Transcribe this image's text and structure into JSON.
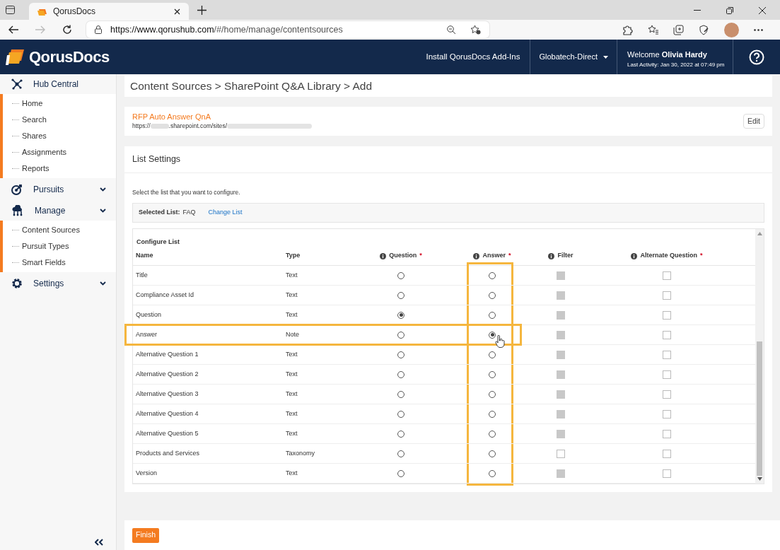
{
  "browser": {
    "tab_title": "QorusDocs",
    "url_host": "https://www.qorushub.com",
    "url_path": "/#/home/manage/contentsources"
  },
  "header": {
    "logo": "QorusDocs",
    "install": "Install QorusDocs Add-Ins",
    "org": "Globatech-Direct",
    "welcome": "Welcome",
    "user": "Olivia Hardy",
    "last_activity": "Last Activity: Jan 30, 2022 at 07:49 pm"
  },
  "sidebar": {
    "sections": [
      {
        "label": "Hub Central",
        "kind": "network",
        "collapsible": false,
        "children": [
          {
            "label": "Home"
          },
          {
            "label": "Search"
          },
          {
            "label": "Shares"
          },
          {
            "label": "Assignments"
          },
          {
            "label": "Reports"
          }
        ]
      },
      {
        "label": "Pursuits",
        "kind": "target",
        "collapsible": true
      },
      {
        "label": "Manage",
        "kind": "cloud",
        "collapsible": true,
        "children": [
          {
            "label": "Content Sources"
          },
          {
            "label": "Pursuit Types"
          },
          {
            "label": "Smart Fields"
          }
        ]
      },
      {
        "label": "Settings",
        "kind": "gear",
        "collapsible": true
      }
    ]
  },
  "breadcrumb": "Content Sources > SharePoint Q&A Library > Add",
  "source": {
    "title": "RFP Auto Answer QnA",
    "url_start": "https://",
    "url_middle": ".sharepoint.com/sites/",
    "edit": "Edit"
  },
  "list_settings": {
    "title": "List Settings",
    "instruction": "Select the list that you want to configure.",
    "selected_label": "Selected List:",
    "selected_value": "FAQ",
    "change": "Change List",
    "configure_title": "Configure List",
    "columns": [
      {
        "label": "Name",
        "info": false,
        "highlighted": false
      },
      {
        "label": "Type",
        "info": false,
        "highlighted": false
      },
      {
        "label": "Question",
        "info": true,
        "marker": "*",
        "highlighted": false
      },
      {
        "label": "Answer",
        "info": true,
        "marker": "*",
        "highlighted": true
      },
      {
        "label": "Filter",
        "info": true,
        "highlighted": false
      },
      {
        "label": "Alternate Question",
        "info": true,
        "marker": "*",
        "highlighted": false
      }
    ],
    "rows": [
      {
        "name": "Title",
        "type": "Text",
        "question": false,
        "answer": false,
        "filter_disabled": true,
        "alternate": false,
        "highlighted": false
      },
      {
        "name": "Compliance Asset Id",
        "type": "Text",
        "question": false,
        "answer": false,
        "filter_disabled": true,
        "alternate": false,
        "highlighted": false
      },
      {
        "name": "Question",
        "type": "Text",
        "question": true,
        "answer": false,
        "filter_disabled": true,
        "alternate": false,
        "highlighted": false
      },
      {
        "name": "Answer",
        "type": "Note",
        "question": false,
        "answer": true,
        "filter_disabled": true,
        "alternate": false,
        "highlighted": true
      },
      {
        "name": "Alternative Question 1",
        "type": "Text",
        "question": false,
        "answer": false,
        "filter_disabled": true,
        "alternate": false,
        "highlighted": false
      },
      {
        "name": "Alternative Question 2",
        "type": "Text",
        "question": false,
        "answer": false,
        "filter_disabled": true,
        "alternate": false,
        "highlighted": false
      },
      {
        "name": "Alternative Question 3",
        "type": "Text",
        "question": false,
        "answer": false,
        "filter_disabled": true,
        "alternate": false,
        "highlighted": false
      },
      {
        "name": "Alternative Question 4",
        "type": "Text",
        "question": false,
        "answer": false,
        "filter_disabled": true,
        "alternate": false,
        "highlighted": false
      },
      {
        "name": "Alternative Question 5",
        "type": "Text",
        "question": false,
        "answer": false,
        "filter_disabled": true,
        "alternate": false,
        "highlighted": false
      },
      {
        "name": "Products and Services",
        "type": "Taxonomy",
        "question": false,
        "answer": false,
        "filter_disabled": false,
        "alternate": false,
        "highlighted": false
      },
      {
        "name": "Version",
        "type": "Text",
        "question": false,
        "answer": false,
        "filter_disabled": true,
        "alternate": false,
        "highlighted": false
      }
    ]
  },
  "finish": "Finish"
}
